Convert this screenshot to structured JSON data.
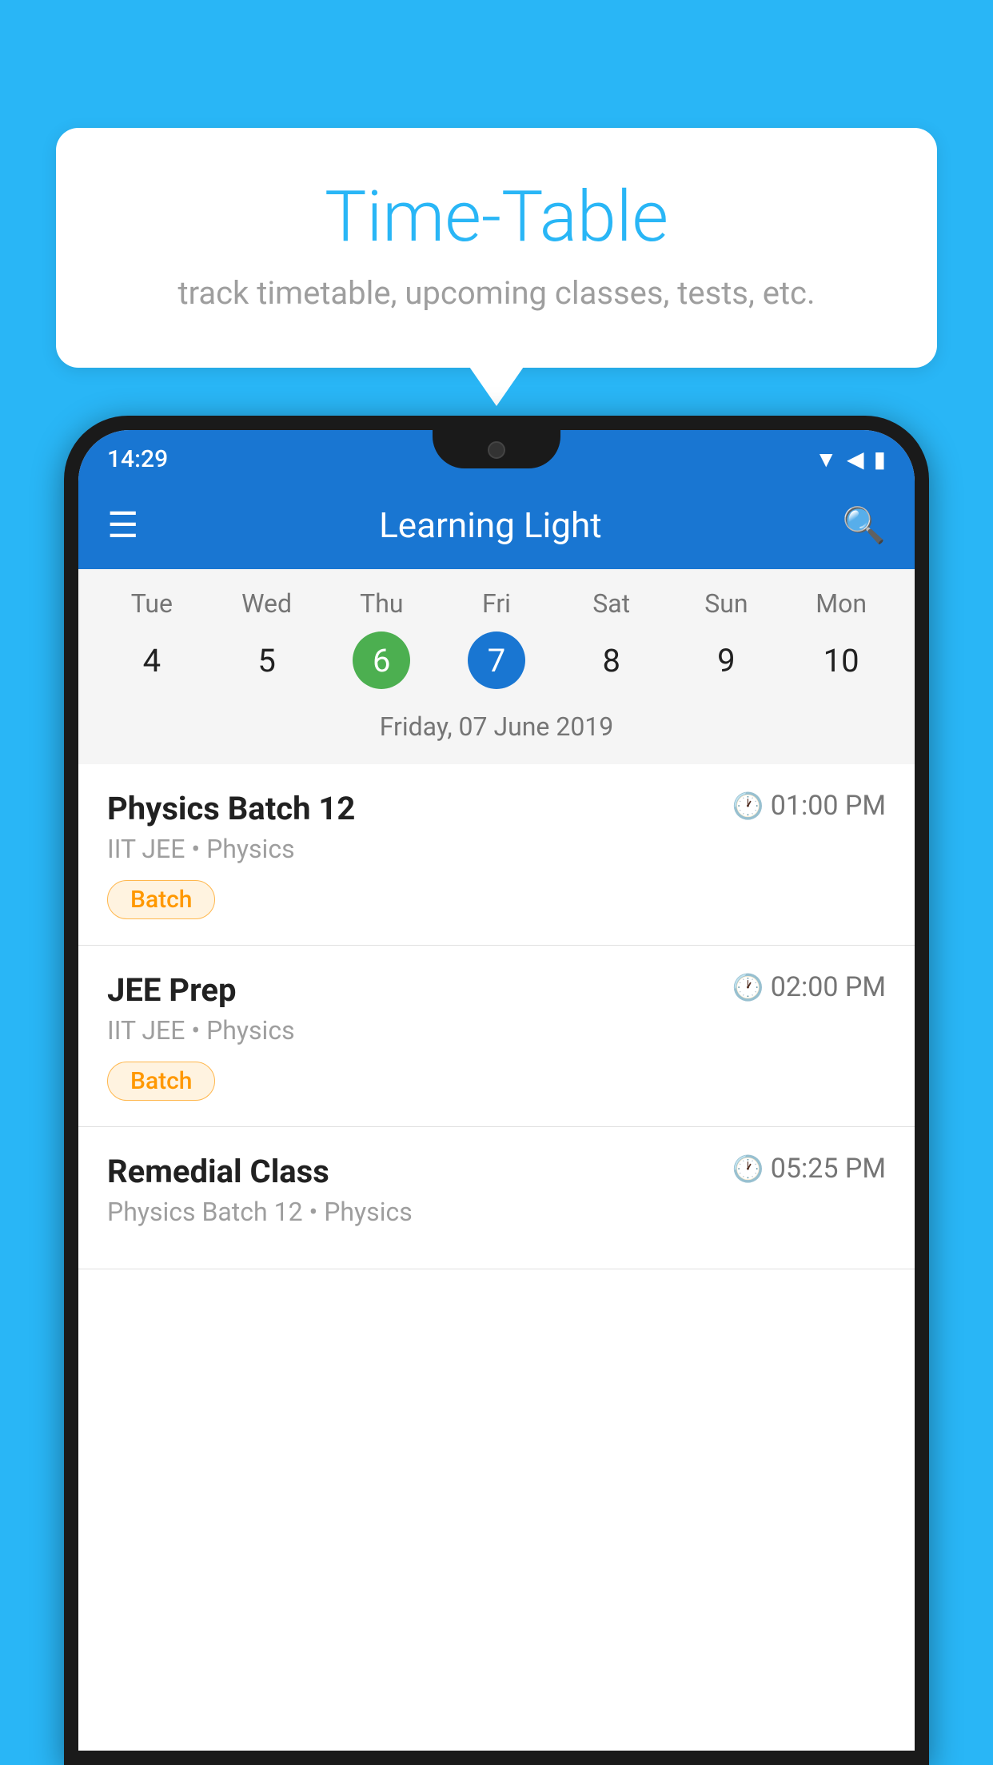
{
  "background_color": "#29B6F6",
  "speech_bubble": {
    "title": "Time-Table",
    "subtitle": "track timetable, upcoming classes, tests, etc."
  },
  "status_bar": {
    "time": "14:29"
  },
  "app_bar": {
    "title": "Learning Light"
  },
  "calendar": {
    "date_label": "Friday, 07 June 2019",
    "days": [
      {
        "name": "Tue",
        "number": "4",
        "state": "normal"
      },
      {
        "name": "Wed",
        "number": "5",
        "state": "normal"
      },
      {
        "name": "Thu",
        "number": "6",
        "state": "today"
      },
      {
        "name": "Fri",
        "number": "7",
        "state": "selected"
      },
      {
        "name": "Sat",
        "number": "8",
        "state": "normal"
      },
      {
        "name": "Sun",
        "number": "9",
        "state": "normal"
      },
      {
        "name": "Mon",
        "number": "10",
        "state": "normal"
      }
    ]
  },
  "schedule": {
    "items": [
      {
        "title": "Physics Batch 12",
        "time": "01:00 PM",
        "subtitle": "IIT JEE • Physics",
        "tag": "Batch"
      },
      {
        "title": "JEE Prep",
        "time": "02:00 PM",
        "subtitle": "IIT JEE • Physics",
        "tag": "Batch"
      },
      {
        "title": "Remedial Class",
        "time": "05:25 PM",
        "subtitle": "Physics Batch 12 • Physics",
        "tag": null
      }
    ]
  }
}
